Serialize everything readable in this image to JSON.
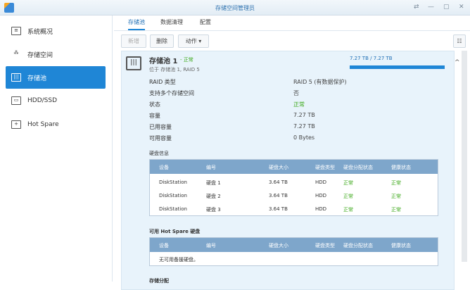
{
  "window": {
    "title": "存储空间管理员",
    "controls": [
      "⇄",
      "—",
      "▢",
      "✕"
    ]
  },
  "sidebar": {
    "items": [
      {
        "label": "系统概况",
        "icon": "overview-icon",
        "glyph": "≡"
      },
      {
        "label": "存储空间",
        "icon": "volume-icon",
        "glyph": "⁂"
      },
      {
        "label": "存储池",
        "icon": "pool-icon",
        "glyph": "|||",
        "selected": true
      },
      {
        "label": "HDD/SSD",
        "icon": "disk-icon",
        "glyph": "▭"
      },
      {
        "label": "Hot Spare",
        "icon": "hot-spare-icon",
        "glyph": "+"
      }
    ]
  },
  "tabs": [
    "存储池",
    "数据清理",
    "配置"
  ],
  "toolbar": {
    "create": "新增",
    "delete": "删除",
    "action": "动作 ▾",
    "view_icon": "☷"
  },
  "pool": {
    "name": "存储池 1",
    "status": "- 正常",
    "location": "位于 存储池 1, RAID 5",
    "usage": "7.27 TB / 7.27 TB",
    "usage_fraction": 1.0,
    "details": [
      {
        "label": "RAID 类型",
        "value": "RAID 5 (有数据保护)"
      },
      {
        "label": "支持多个存储空间",
        "value": "否"
      },
      {
        "label": "状态",
        "value": "正常",
        "green": true
      },
      {
        "label": "容量",
        "value": "7.27 TB"
      },
      {
        "label": "已用容量",
        "value": "7.27 TB"
      },
      {
        "label": "可用容量",
        "value": "0 Bytes"
      }
    ]
  },
  "disk_info": {
    "title": "硬盘信息",
    "headers": [
      "设备",
      "编号",
      "硬盘大小",
      "硬盘类型",
      "硬盘分配状态",
      "健康状态"
    ],
    "rows": [
      [
        "DiskStation",
        "硬盘 1",
        "3.64 TB",
        "HDD",
        "正常",
        "正常"
      ],
      [
        "DiskStation",
        "硬盘 2",
        "3.64 TB",
        "HDD",
        "正常",
        "正常"
      ],
      [
        "DiskStation",
        "硬盘 3",
        "3.64 TB",
        "HDD",
        "正常",
        "正常"
      ]
    ]
  },
  "hot_spare": {
    "title": "可用 Hot Spare 硬盘",
    "headers": [
      "设备",
      "编号",
      "硬盘大小",
      "硬盘类型",
      "硬盘分配状态",
      "健康状态"
    ],
    "empty": "无可用备援硬盘。"
  },
  "next_section": "存储分配",
  "colors": {
    "accent": "#1f86d6",
    "ok": "#3ca81a"
  }
}
